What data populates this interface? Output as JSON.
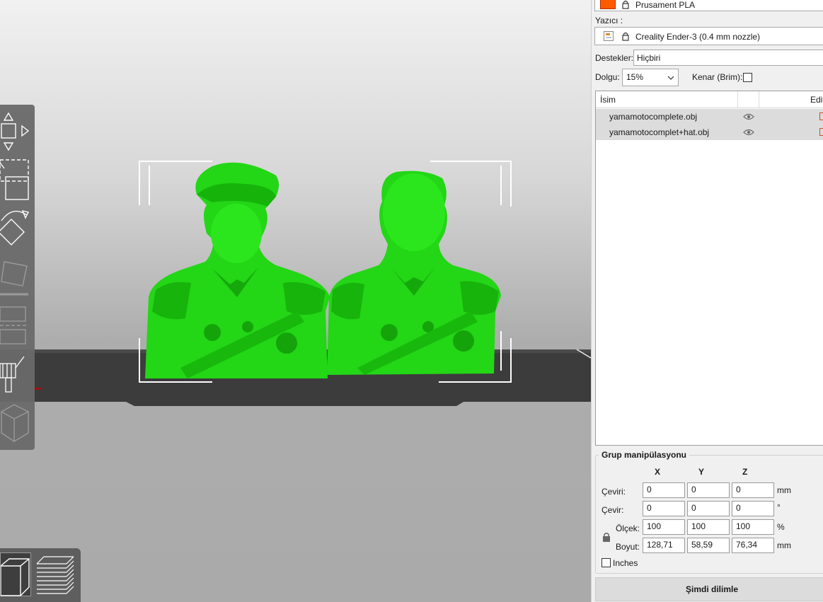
{
  "filament": {
    "name": "Prusament PLA",
    "swatch_color": "#ff5a00"
  },
  "printer": {
    "label": "Yazıcı :",
    "name": "Creality Ender-3 (0.4 mm nozzle)"
  },
  "supports": {
    "label": "Destekler:",
    "value": "Hiçbiri"
  },
  "infill": {
    "label": "Dolgu:",
    "value": "15%"
  },
  "brim": {
    "label": "Kenar (Brim):",
    "checked": false
  },
  "object_list": {
    "columns": [
      "İsim",
      "Edit"
    ],
    "items": [
      {
        "name": "yamamotocomplete.obj"
      },
      {
        "name": "yamamotocomplet+hat.obj"
      }
    ]
  },
  "group": {
    "title": "Grup manipülasyonu",
    "axes": [
      "X",
      "Y",
      "Z"
    ],
    "rows": [
      {
        "label": "Çeviri:",
        "values": [
          "0",
          "0",
          "0"
        ],
        "unit": "mm"
      },
      {
        "label": "Çevir:",
        "values": [
          "0",
          "0",
          "0"
        ],
        "unit": "°"
      },
      {
        "label": "Ölçek:",
        "values": [
          "100",
          "100",
          "100"
        ],
        "unit": "%"
      },
      {
        "label": "Boyut:",
        "values": [
          "128,71",
          "58,59",
          "76,34"
        ],
        "unit": "mm"
      }
    ],
    "inches_label": "Inches"
  },
  "slice_button": "Şimdi dilimle",
  "colors": {
    "model": "#1fdc12",
    "bed": "#3a3a3a",
    "toolbar": "#6a6a6a"
  }
}
